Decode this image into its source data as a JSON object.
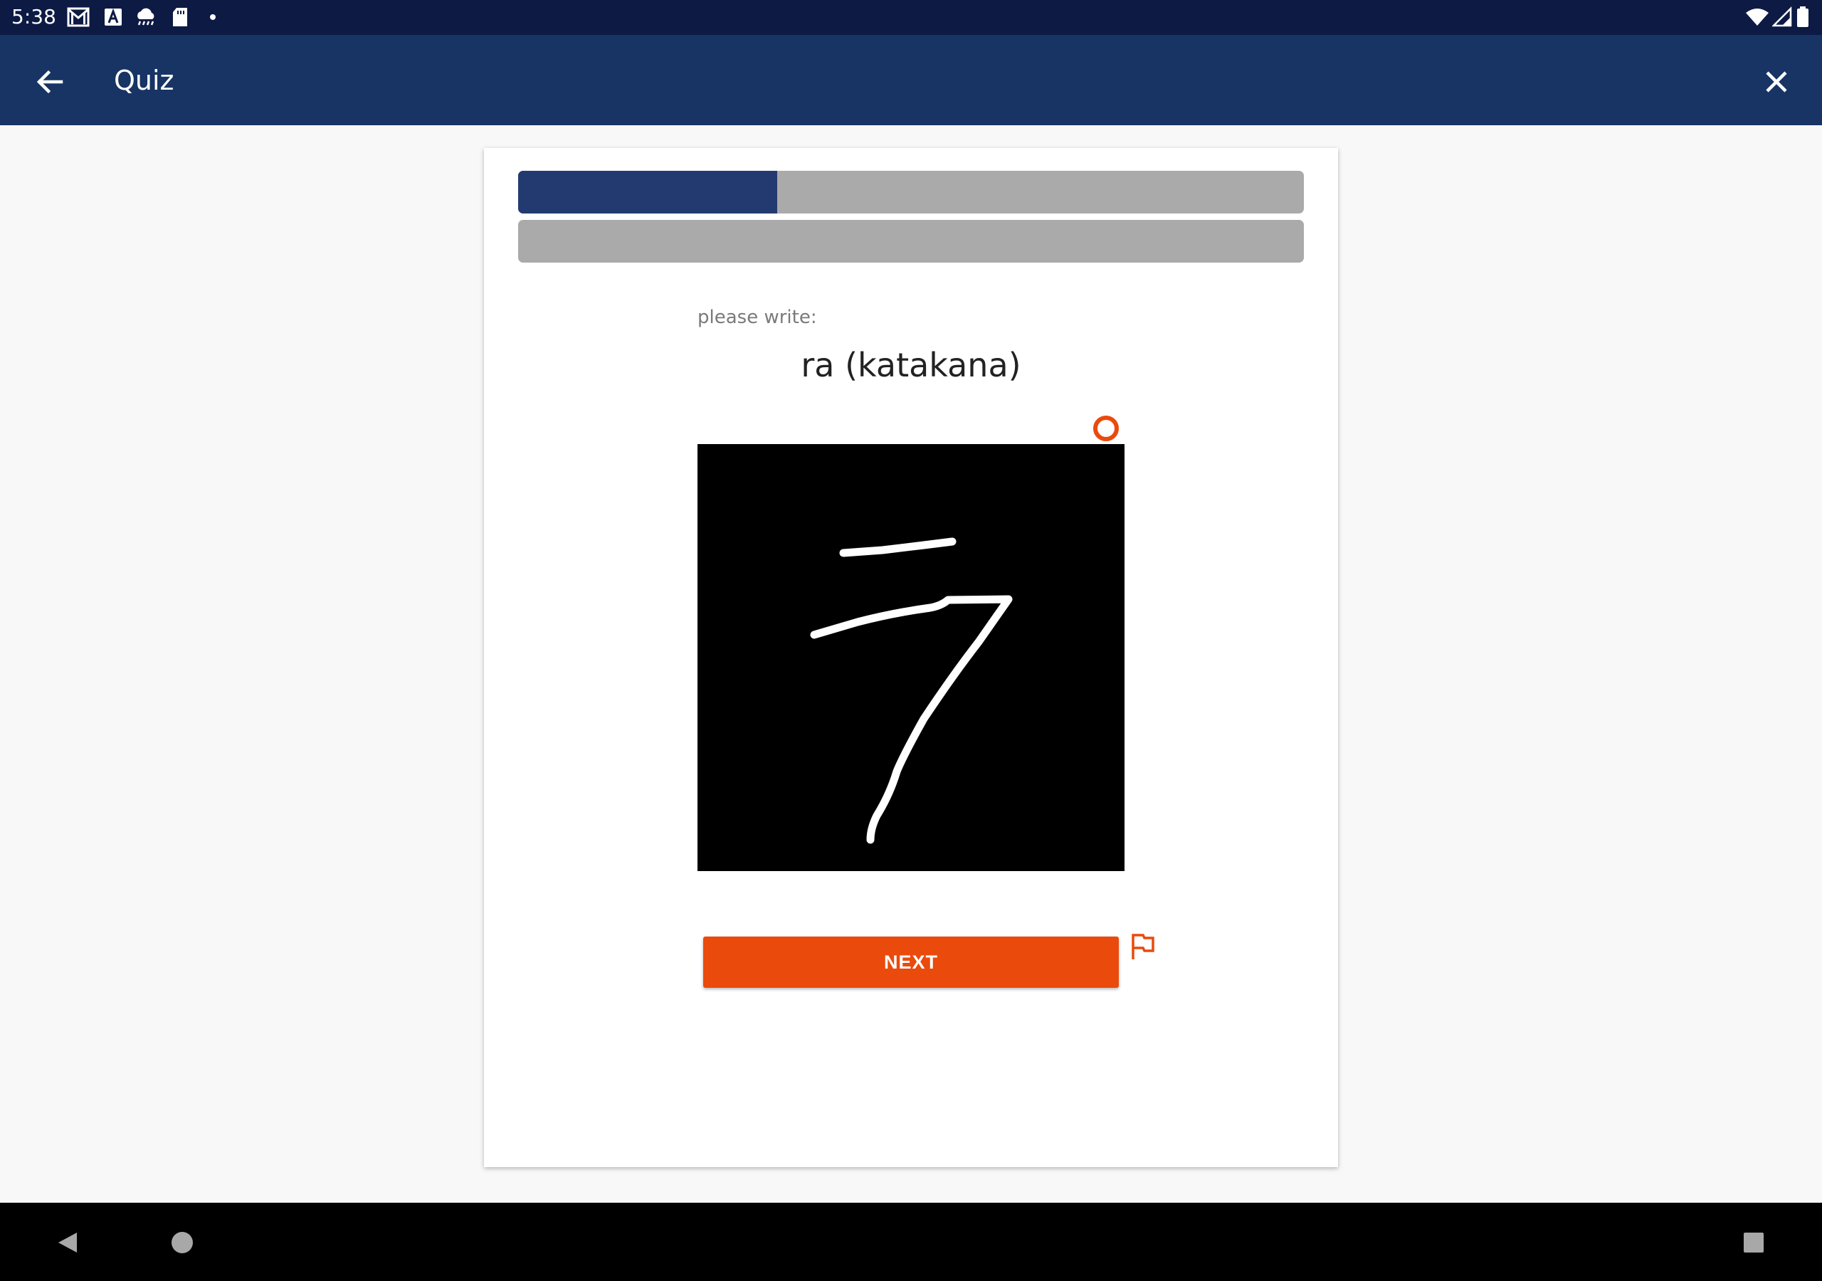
{
  "status_bar": {
    "time": "5:38",
    "left_icons": [
      "gmail-icon",
      "a-icon",
      "weather-icon",
      "sd-card-icon",
      "dot-icon"
    ],
    "right_icons": [
      "wifi-icon",
      "signal-icon",
      "battery-icon"
    ]
  },
  "app_bar": {
    "title": "Quiz",
    "back_icon": "arrow-back-icon",
    "close_icon": "close-icon",
    "background_color": "#173464"
  },
  "quiz": {
    "progress_primary": 0.33,
    "progress_secondary": 0.0,
    "progress_color": "#233a71",
    "prompt_label": "please write:",
    "prompt": "ra (katakana)",
    "canvas_indicator_icon": "circle-outline-icon",
    "canvas_stroke_color": "#ffffff",
    "next_label": "NEXT",
    "flag_icon": "flag-icon",
    "accent_color": "#ea4a0c"
  },
  "nav_bar": {
    "icons": [
      "nav-back-icon",
      "nav-home-icon",
      "nav-recents-icon"
    ]
  }
}
